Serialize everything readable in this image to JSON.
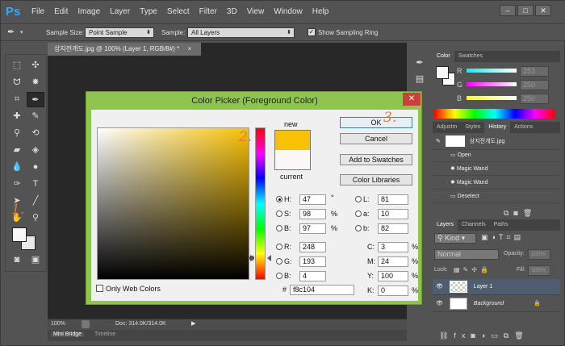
{
  "app": {
    "logo": "Ps"
  },
  "menu": [
    "File",
    "Edit",
    "Image",
    "Layer",
    "Type",
    "Select",
    "Filter",
    "3D",
    "View",
    "Window",
    "Help"
  ],
  "window_buttons": [
    "–",
    "□",
    "✕"
  ],
  "options": {
    "sample_size_label": "Sample Size:",
    "sample_size_value": "Point Sample",
    "sample_label": "Sample:",
    "sample_value": "All Layers",
    "show_ring_label": "Show Sampling Ring"
  },
  "document": {
    "tab_title": "상지전개도.jpg @ 100% (Layer 1, RGB/8#) *",
    "tab_close": "×",
    "zoom": "100%",
    "doc_size": "Doc: 314.0K/314.0K"
  },
  "bottom_tabs": [
    "Mini Bridge",
    "Timeline"
  ],
  "color_panel": {
    "tabs": [
      "Color",
      "Swatches"
    ],
    "channels": [
      {
        "label": "R",
        "value": "253",
        "color": "#ff5050"
      },
      {
        "label": "G",
        "value": "250",
        "color": "#ff50ff"
      },
      {
        "label": "B",
        "value": "250",
        "color": "#ffff50"
      }
    ]
  },
  "history_panel": {
    "tabs": [
      "Adjustm",
      "Styles",
      "History",
      "Actions"
    ],
    "snapshot": "상지전개도.jpg",
    "items": [
      "Open",
      "Magic Wand",
      "Magic Wand",
      "Deselect"
    ]
  },
  "layers_panel": {
    "tabs": [
      "Layers",
      "Channels",
      "Paths"
    ],
    "kind_label": "Kind",
    "blend_mode": "Normal",
    "opacity_label": "Opacity:",
    "opacity_value": "100%",
    "lock_label": "Lock:",
    "fill_label": "Fill:",
    "fill_value": "100%",
    "layers": [
      {
        "name": "Layer 1",
        "selected": true
      },
      {
        "name": "Background",
        "selected": false
      }
    ]
  },
  "dialog": {
    "title": "Color Picker (Foreground Color)",
    "close": "✕",
    "new_label": "new",
    "current_label": "current",
    "new_color": "#f8c104",
    "current_color": "#fcf7f7",
    "buttons": {
      "ok": "OK",
      "cancel": "Cancel",
      "add_swatches": "Add to Swatches",
      "color_libraries": "Color Libraries"
    },
    "hsb": [
      {
        "label": "H:",
        "value": "47",
        "unit": "°",
        "checked": true
      },
      {
        "label": "S:",
        "value": "98",
        "unit": "%",
        "checked": false
      },
      {
        "label": "B:",
        "value": "97",
        "unit": "%",
        "checked": false
      }
    ],
    "rgb": [
      {
        "label": "R:",
        "value": "248"
      },
      {
        "label": "G:",
        "value": "193"
      },
      {
        "label": "B:",
        "value": "4"
      }
    ],
    "lab": [
      {
        "label": "L:",
        "value": "81"
      },
      {
        "label": "a:",
        "value": "10"
      },
      {
        "label": "b:",
        "value": "82"
      }
    ],
    "cmyk": [
      {
        "label": "C:",
        "value": "3",
        "unit": "%"
      },
      {
        "label": "M:",
        "value": "24",
        "unit": "%"
      },
      {
        "label": "Y:",
        "value": "100",
        "unit": "%"
      },
      {
        "label": "K:",
        "value": "0",
        "unit": "%"
      }
    ],
    "hex_label": "#",
    "hex_value": "f8c104",
    "web_colors_label": "Only Web Colors"
  },
  "annotations": [
    "1.",
    "2.",
    "3."
  ]
}
